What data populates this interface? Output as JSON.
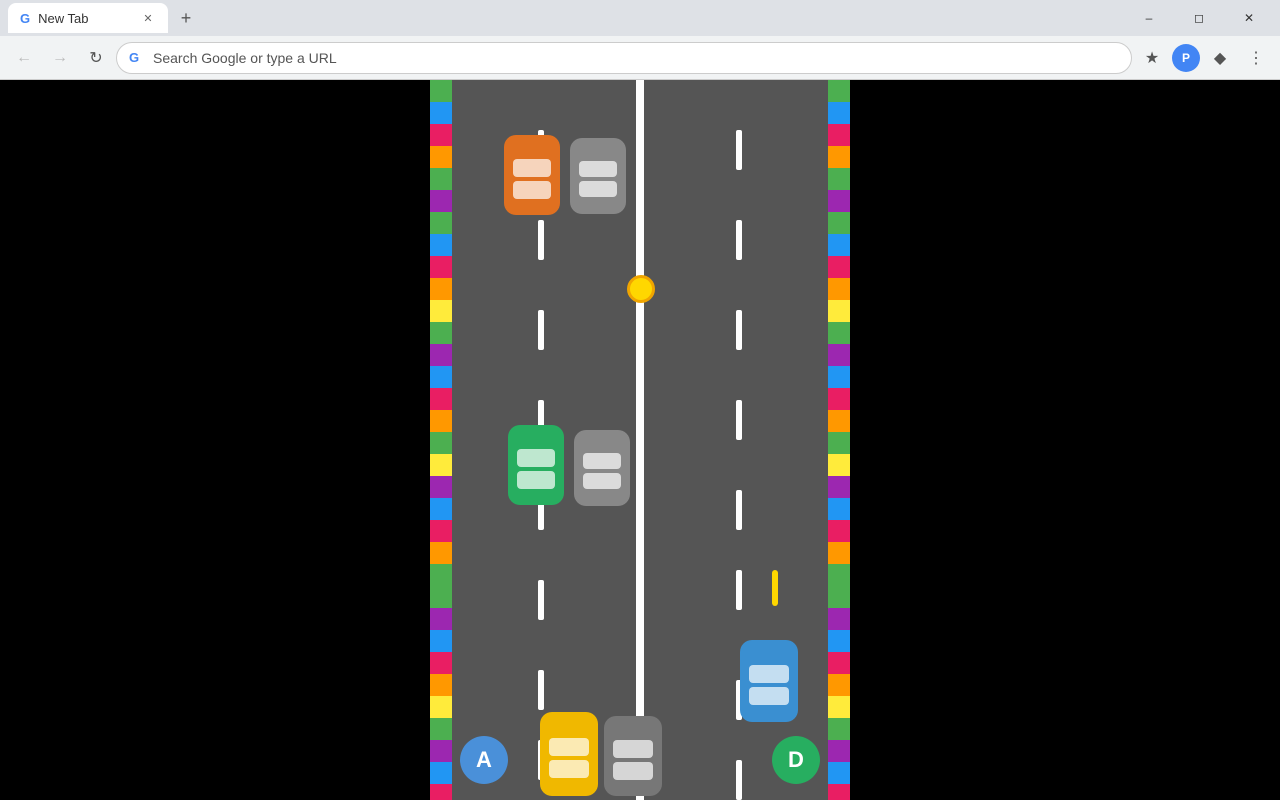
{
  "browser": {
    "tab_title": "New Tab",
    "address_placeholder": "Search Google or type a URL",
    "address_text": "Search Google or type a URL"
  },
  "game": {
    "border_colors_left": [
      "#4caf50",
      "#2196f3",
      "#e91e63",
      "#ff9800",
      "#4caf50",
      "#9c27b0",
      "#4caf50",
      "#2196f3",
      "#e91e63",
      "#ff9800",
      "#ffeb3b",
      "#4caf50",
      "#9c27b0",
      "#2196f3",
      "#e91e63",
      "#ff9800",
      "#4caf50",
      "#ffeb3b",
      "#9c27b0",
      "#2196f3",
      "#e91e63",
      "#ff9800",
      "#4caf50",
      "#4caf50",
      "#9c27b0",
      "#2196f3",
      "#e91e63",
      "#ff9800",
      "#ffeb3b",
      "#4caf50",
      "#9c27b0",
      "#2196f3",
      "#e91e63"
    ],
    "border_colors_right": [
      "#4caf50",
      "#2196f3",
      "#e91e63",
      "#ff9800",
      "#4caf50",
      "#9c27b0",
      "#4caf50",
      "#2196f3",
      "#e91e63",
      "#ff9800",
      "#ffeb3b",
      "#4caf50",
      "#9c27b0",
      "#2196f3",
      "#e91e63",
      "#ff9800",
      "#4caf50",
      "#ffeb3b",
      "#9c27b0",
      "#2196f3",
      "#e91e63",
      "#ff9800",
      "#4caf50",
      "#4caf50",
      "#9c27b0",
      "#2196f3",
      "#e91e63",
      "#ff9800",
      "#ffeb3b",
      "#4caf50",
      "#9c27b0",
      "#2196f3",
      "#e91e63"
    ],
    "player_a_label": "A",
    "player_d_label": "D"
  }
}
